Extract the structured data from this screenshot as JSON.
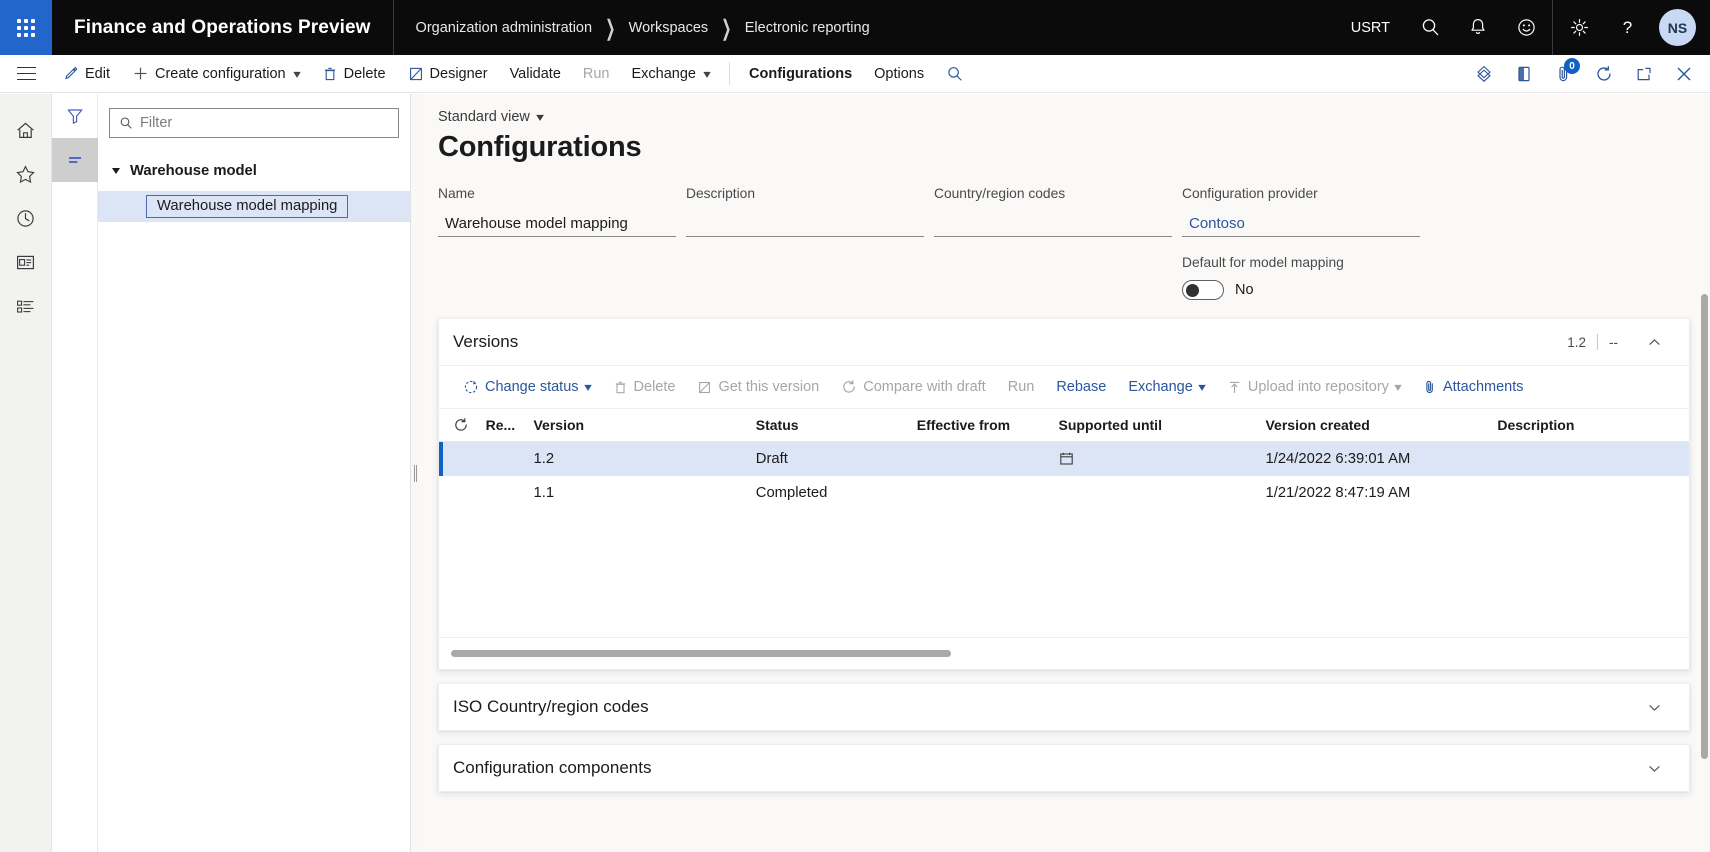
{
  "topbar": {
    "waffle_label": "app-launcher",
    "app_title": "Finance and Operations Preview",
    "breadcrumb": [
      "Organization administration",
      "Workspaces",
      "Electronic reporting"
    ],
    "company": "USRT",
    "icons": [
      "search-icon",
      "bell-icon",
      "smiley-icon",
      "gear-icon",
      "help-icon"
    ],
    "avatar_initials": "NS"
  },
  "commandbar": {
    "items": [
      {
        "label": "Edit",
        "icon": "pencil-icon",
        "disabled": false,
        "caret": false,
        "strong": false
      },
      {
        "label": "Create configuration",
        "icon": "plus-icon",
        "disabled": false,
        "caret": true,
        "strong": false
      },
      {
        "label": "Delete",
        "icon": "trash-icon",
        "disabled": false,
        "caret": false,
        "strong": false
      },
      {
        "label": "Designer",
        "icon": "designer-icon",
        "disabled": false,
        "caret": false,
        "strong": false
      },
      {
        "label": "Validate",
        "icon": "",
        "disabled": false,
        "caret": false,
        "strong": false
      },
      {
        "label": "Run",
        "icon": "",
        "disabled": true,
        "caret": false,
        "strong": false
      },
      {
        "label": "Exchange",
        "icon": "",
        "disabled": false,
        "caret": true,
        "strong": false
      }
    ],
    "tabs": [
      {
        "label": "Configurations",
        "active": true
      },
      {
        "label": "Options",
        "active": false
      }
    ],
    "right_icons": [
      "share-icon",
      "office-app-icon",
      "attachments-icon",
      "refresh-icon",
      "popout-icon",
      "close-icon"
    ],
    "attachment_count": "0"
  },
  "rail": {
    "items": [
      "home-icon",
      "favorites-star-icon",
      "recent-clock-icon",
      "workspaces-icon",
      "modules-list-icon"
    ]
  },
  "treepanel": {
    "tabs": [
      {
        "name": "filter-tab",
        "icon": "funnel-icon",
        "active": false
      },
      {
        "name": "list-tab",
        "icon": "lines-icon",
        "active": true
      }
    ],
    "filter": {
      "value": "",
      "placeholder": "Filter",
      "icon": "search-icon"
    },
    "tree": {
      "root_label": "Warehouse model",
      "child_label": "Warehouse model mapping"
    }
  },
  "main": {
    "view_selector": "Standard view",
    "page_title": "Configurations",
    "fields": [
      {
        "label": "Name",
        "value": "Warehouse model mapping",
        "link": false
      },
      {
        "label": "Description",
        "value": "",
        "link": false
      },
      {
        "label": "Country/region codes",
        "value": "",
        "link": false
      },
      {
        "label": "Configuration provider",
        "value": "Contoso",
        "link": true
      }
    ],
    "toggle": {
      "label": "Default for model mapping",
      "value": "No"
    },
    "versions": {
      "title": "Versions",
      "summary_version": "1.2",
      "summary_extra": "--",
      "collapse_icon": "chevron-up-icon",
      "toolbar": [
        {
          "label": "Change status",
          "icon": "status-icon",
          "disabled": false,
          "caret": true
        },
        {
          "label": "Delete",
          "icon": "trash-icon",
          "disabled": true,
          "caret": false
        },
        {
          "label": "Get this version",
          "icon": "get-version-icon",
          "disabled": true,
          "caret": false
        },
        {
          "label": "Compare with draft",
          "icon": "compare-icon",
          "disabled": true,
          "caret": false
        },
        {
          "label": "Run",
          "icon": "",
          "disabled": true,
          "caret": false
        },
        {
          "label": "Rebase",
          "icon": "",
          "disabled": false,
          "caret": false
        },
        {
          "label": "Exchange",
          "icon": "",
          "disabled": false,
          "caret": true
        },
        {
          "label": "Upload into repository",
          "icon": "upload-icon",
          "disabled": true,
          "caret": true
        },
        {
          "label": "Attachments",
          "icon": "paperclip-icon",
          "disabled": false,
          "caret": false
        }
      ],
      "columns": [
        "Re...",
        "Version",
        "Status",
        "Effective from",
        "Supported until",
        "Version created",
        "Description"
      ],
      "rows": [
        {
          "re": "",
          "version": "1.2",
          "status": "Draft",
          "effective_from": "",
          "supported_until": "",
          "supported_until_icon": "calendar-icon",
          "version_created": "1/24/2022 6:39:01 AM",
          "description": "",
          "selected": true
        },
        {
          "re": "",
          "version": "1.1",
          "status": "Completed",
          "effective_from": "",
          "supported_until": "",
          "supported_until_icon": "",
          "version_created": "1/21/2022 8:47:19 AM",
          "description": "",
          "selected": false
        }
      ]
    },
    "sections": [
      {
        "title": "ISO Country/region codes",
        "icon": "chevron-down-icon"
      },
      {
        "title": "Configuration components",
        "icon": "chevron-down-icon"
      }
    ]
  },
  "colors": {
    "brand_blue": "#2266cc",
    "link_blue": "#2b579a",
    "accent_blue": "#1061c4",
    "selection_row": "#dbe5f6",
    "topbar_black": "#0b0b0b",
    "canvas": "#faf9f8"
  }
}
